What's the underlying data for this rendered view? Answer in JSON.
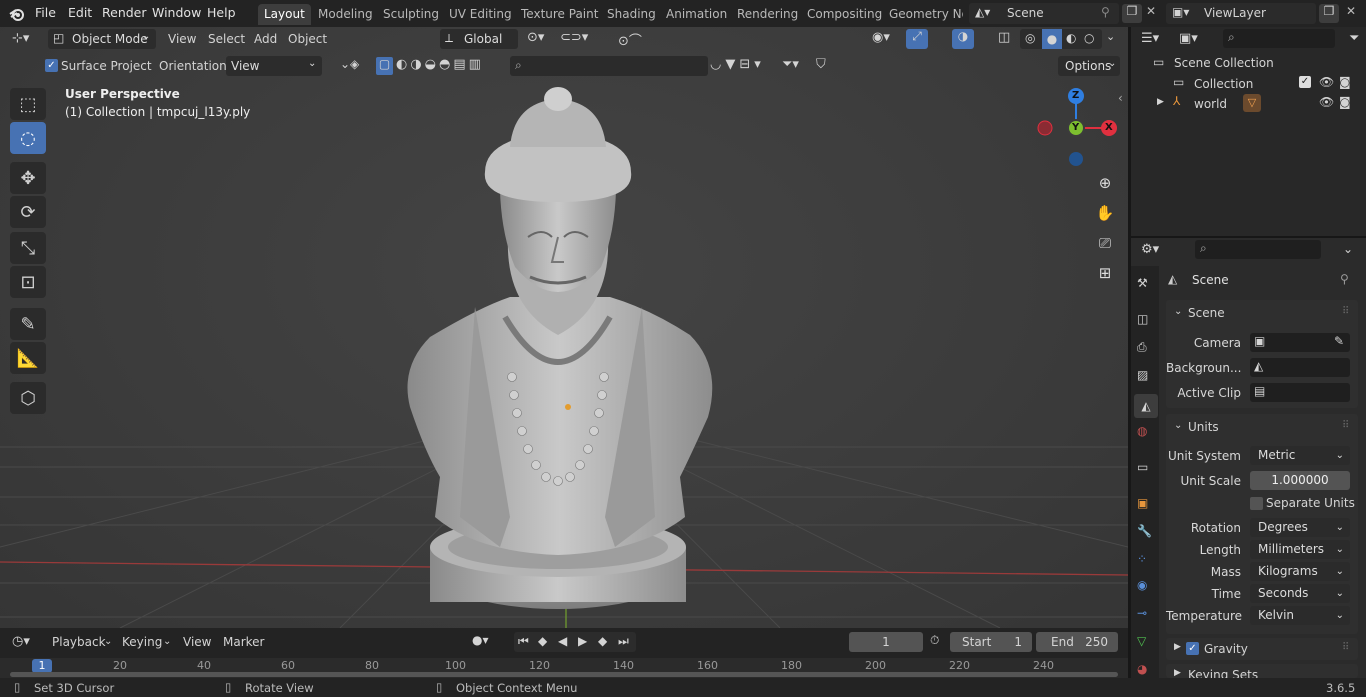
{
  "menus": [
    "File",
    "Edit",
    "Render",
    "Window",
    "Help"
  ],
  "workspaces": [
    "Layout",
    "Modeling",
    "Sculpting",
    "UV Editing",
    "Texture Paint",
    "Shading",
    "Animation",
    "Rendering",
    "Compositing",
    "Geometry Noc"
  ],
  "scene_name": "Scene",
  "view_layer": "ViewLayer",
  "header": {
    "mode": "Object Mode",
    "view": "View",
    "select": "Select",
    "add": "Add",
    "object": "Object",
    "orientation_global": "Global"
  },
  "snap_bar": {
    "surface_project": "Surface Project",
    "orientation_label": "Orientation:",
    "orientation_value": "View",
    "options": "Options"
  },
  "viewport": {
    "perspective": "User Perspective",
    "object_info": "(1) Collection | tmpcuj_l13y.ply"
  },
  "gizmo": {
    "z": "Z",
    "y": "Y",
    "x": "X"
  },
  "outliner": {
    "scene_collection": "Scene Collection",
    "collection": "Collection",
    "world": "world"
  },
  "props": {
    "context": "Scene",
    "scene_panel": "Scene",
    "camera_label": "Camera",
    "background_label": "Backgroun...",
    "active_clip_label": "Active Clip",
    "units_panel": "Units",
    "unit_system_label": "Unit System",
    "unit_system": "Metric",
    "unit_scale_label": "Unit Scale",
    "unit_scale": "1.000000",
    "separate_units": "Separate Units",
    "rotation_label": "Rotation",
    "rotation": "Degrees",
    "length_label": "Length",
    "length": "Millimeters",
    "mass_label": "Mass",
    "mass": "Kilograms",
    "time_label": "Time",
    "time": "Seconds",
    "temperature_label": "Temperature",
    "temperature": "Kelvin",
    "gravity": "Gravity",
    "keying_sets": "Keying Sets"
  },
  "timeline": {
    "playback": "Playback",
    "keying": "Keying",
    "view": "View",
    "marker": "Marker",
    "current_frame": "1",
    "start_label": "Start",
    "start": "1",
    "end_label": "End",
    "end": "250",
    "ruler": [
      "1",
      "20",
      "40",
      "60",
      "80",
      "100",
      "120",
      "140",
      "160",
      "180",
      "200",
      "220",
      "240"
    ]
  },
  "status": {
    "left": "Set 3D Cursor",
    "middle": "Rotate View",
    "right": "Object Context Menu",
    "version": "3.6.5"
  },
  "colors": {
    "accent": "#4772b3",
    "x_axis": "#e0303f",
    "y_axis": "#7dbf2f",
    "z_axis": "#2f7ee0"
  }
}
